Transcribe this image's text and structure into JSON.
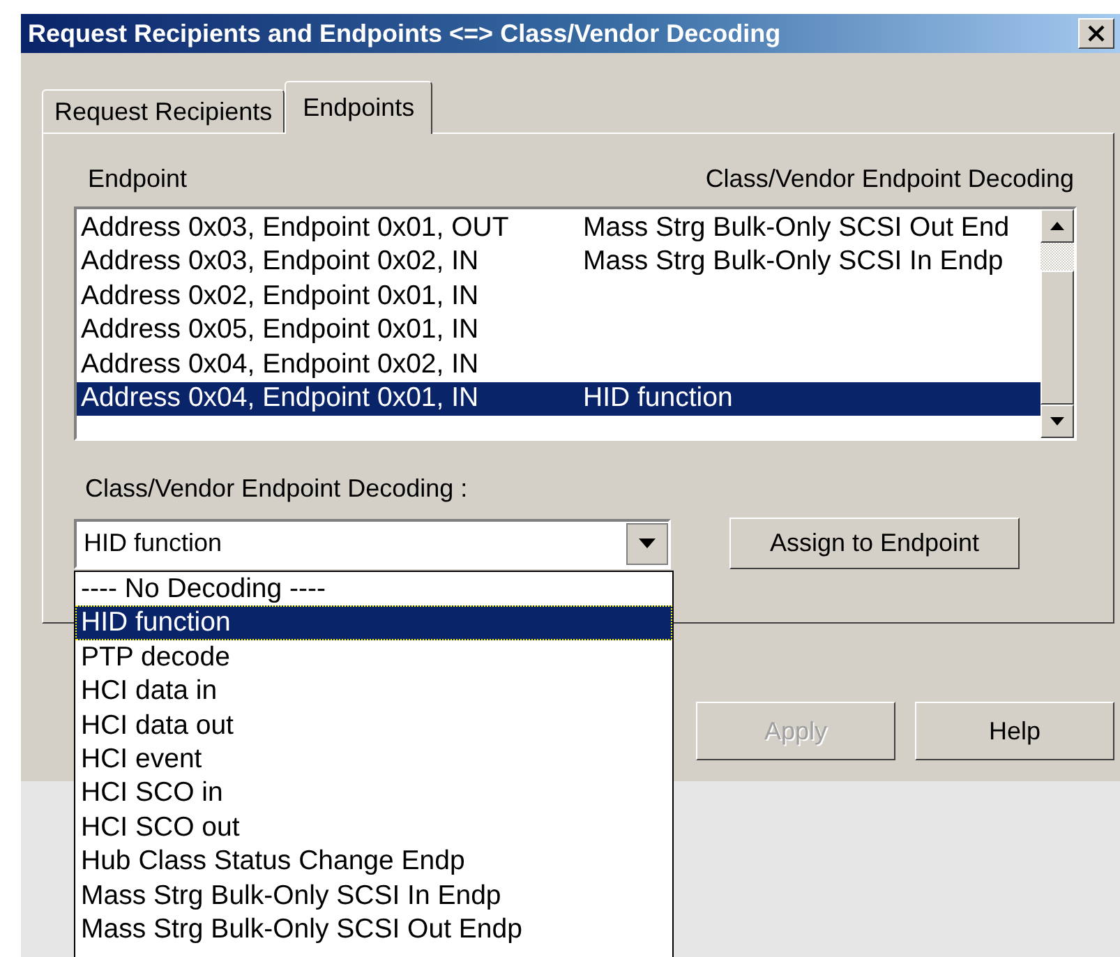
{
  "window": {
    "title": "Request Recipients and Endpoints <=> Class/Vendor Decoding"
  },
  "tabs": [
    {
      "label": "Request Recipients",
      "selected": false
    },
    {
      "label": "Endpoints",
      "selected": true
    }
  ],
  "endpoint_list": {
    "columns": [
      "Endpoint",
      "Class/Vendor Endpoint Decoding"
    ],
    "rows": [
      {
        "endpoint": "Address 0x03, Endpoint 0x01, OUT",
        "decoding": "Mass Strg Bulk-Only SCSI Out End",
        "selected": false
      },
      {
        "endpoint": "Address 0x03, Endpoint 0x02, IN",
        "decoding": "Mass Strg Bulk-Only SCSI In Endp",
        "selected": false
      },
      {
        "endpoint": "Address 0x02, Endpoint 0x01, IN",
        "decoding": "",
        "selected": false
      },
      {
        "endpoint": "Address 0x05, Endpoint 0x01, IN",
        "decoding": "",
        "selected": false
      },
      {
        "endpoint": "Address 0x04, Endpoint 0x02, IN",
        "decoding": "",
        "selected": false
      },
      {
        "endpoint": "Address 0x04, Endpoint 0x01, IN",
        "decoding": "HID function",
        "selected": true
      }
    ]
  },
  "decoding_label": "Class/Vendor Endpoint Decoding :",
  "decoding_combo": {
    "value": "HID function",
    "expanded": true,
    "options": [
      {
        "label": "---- No Decoding ----",
        "selected": false
      },
      {
        "label": "HID function",
        "selected": true
      },
      {
        "label": "PTP decode",
        "selected": false
      },
      {
        "label": "HCI data in",
        "selected": false
      },
      {
        "label": "HCI data out",
        "selected": false
      },
      {
        "label": "HCI event",
        "selected": false
      },
      {
        "label": "HCI SCO in",
        "selected": false
      },
      {
        "label": "HCI SCO out",
        "selected": false
      },
      {
        "label": "Hub Class Status Change Endp",
        "selected": false
      },
      {
        "label": "Mass Strg Bulk-Only SCSI In Endp",
        "selected": false
      },
      {
        "label": "Mass Strg Bulk-Only SCSI Out Endp",
        "selected": false
      }
    ]
  },
  "assign_button": "Assign to Endpoint",
  "buttons": [
    {
      "label": "Apply",
      "disabled": true
    },
    {
      "label": "Help",
      "disabled": false
    }
  ]
}
